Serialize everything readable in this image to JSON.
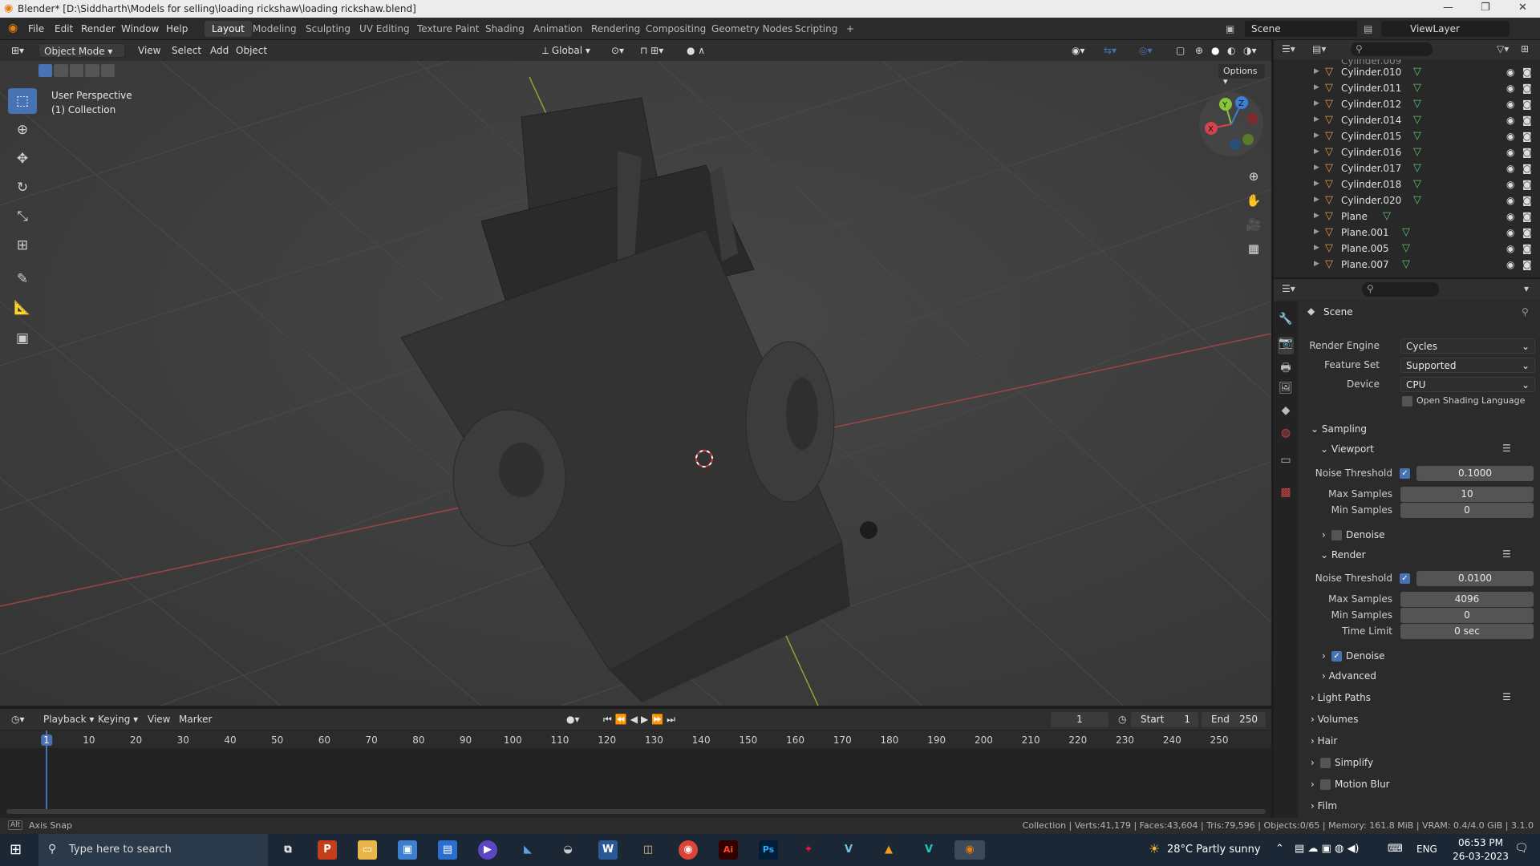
{
  "app": {
    "title": "Blender* [D:\\Siddharth\\Models for selling\\loading rickshaw\\loading rickshaw.blend]"
  },
  "menu": [
    "File",
    "Edit",
    "Render",
    "Window",
    "Help"
  ],
  "workspaces": [
    "Layout",
    "Modeling",
    "Sculpting",
    "UV Editing",
    "Texture Paint",
    "Shading",
    "Animation",
    "Rendering",
    "Compositing",
    "Geometry Nodes",
    "Scripting",
    "+"
  ],
  "active_workspace": "Layout",
  "scene": {
    "scene_label": "Scene",
    "viewlayer_label": "ViewLayer"
  },
  "viewport_header": {
    "mode": "Object Mode",
    "view": "View",
    "select": "Select",
    "add": "Add",
    "object": "Object",
    "orientation": "Global",
    "options": "Options"
  },
  "viewport": {
    "perspective": "User Perspective",
    "collection": "(1) Collection"
  },
  "outliner": {
    "items": [
      {
        "name": "Cylinder.010"
      },
      {
        "name": "Cylinder.011"
      },
      {
        "name": "Cylinder.012"
      },
      {
        "name": "Cylinder.014"
      },
      {
        "name": "Cylinder.015"
      },
      {
        "name": "Cylinder.016"
      },
      {
        "name": "Cylinder.017"
      },
      {
        "name": "Cylinder.018"
      },
      {
        "name": "Cylinder.020"
      },
      {
        "name": "Plane"
      },
      {
        "name": "Plane.001"
      },
      {
        "name": "Plane.005"
      },
      {
        "name": "Plane.007"
      }
    ]
  },
  "properties": {
    "header": "Scene",
    "render_engine_label": "Render Engine",
    "render_engine": "Cycles",
    "feature_set_label": "Feature Set",
    "feature_set": "Supported",
    "device_label": "Device",
    "device": "CPU",
    "osl_label": "Open Shading Language",
    "sampling": "Sampling",
    "viewport_label": "Viewport",
    "vp_noise_label": "Noise Threshold",
    "vp_noise": "0.1000",
    "vp_max_label": "Max Samples",
    "vp_max": "10",
    "vp_min_label": "Min Samples",
    "vp_min": "0",
    "denoise_label": "Denoise",
    "render_label": "Render",
    "r_noise_label": "Noise Threshold",
    "r_noise": "0.0100",
    "r_max_label": "Max Samples",
    "r_max": "4096",
    "r_min_label": "Min Samples",
    "r_min": "0",
    "time_limit_label": "Time Limit",
    "time_limit": "0 sec",
    "r_denoise_label": "Denoise",
    "advanced": "Advanced",
    "light_paths": "Light Paths",
    "volumes": "Volumes",
    "hair": "Hair",
    "simplify": "Simplify",
    "motion_blur": "Motion Blur",
    "film": "Film"
  },
  "timeline": {
    "playback": "Playback",
    "keying": "Keying",
    "view": "View",
    "marker": "Marker",
    "current": "1",
    "start_label": "Start",
    "start": "1",
    "end_label": "End",
    "end": "250",
    "ticks": [
      "1",
      "10",
      "20",
      "30",
      "40",
      "50",
      "60",
      "70",
      "80",
      "90",
      "100",
      "110",
      "120",
      "130",
      "140",
      "150",
      "160",
      "170",
      "180",
      "190",
      "200",
      "210",
      "220",
      "230",
      "240",
      "250"
    ]
  },
  "status": {
    "left": "Axis Snap",
    "right": "Collection | Verts:41,179 | Faces:43,604 | Tris:79,596 | Objects:0/65 | Memory: 161.8 MiB | VRAM: 0.4/4.0 GiB | 3.1.0"
  },
  "taskbar": {
    "search": "Type here to search",
    "weather": "28°C  Partly sunny",
    "lang": "ENG",
    "time": "06:53 PM",
    "date": "26-03-2023"
  },
  "colors": {
    "accent": "#4772b3",
    "object": "#e69b4e",
    "mesh": "#5fc26b",
    "axis_x": "#d8434b",
    "axis_y": "#8ac43a",
    "axis_z": "#3b7fd6"
  }
}
